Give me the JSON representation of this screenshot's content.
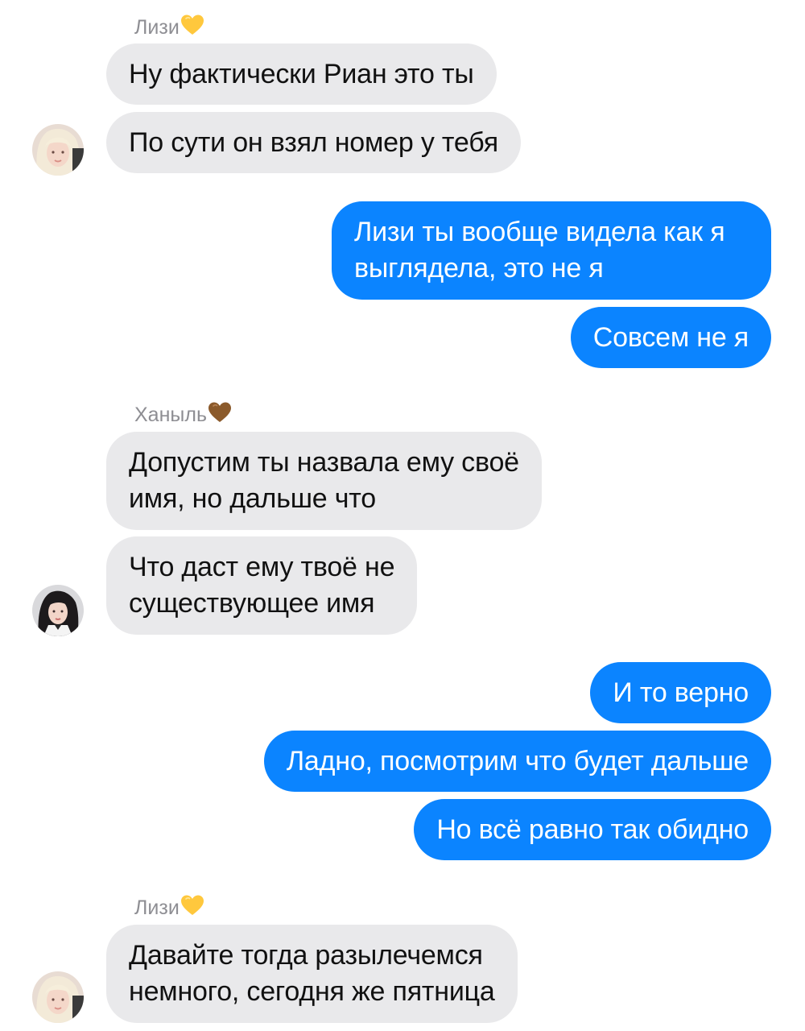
{
  "colors": {
    "incoming_bubble": "#e9e9eb",
    "outgoing_bubble": "#0b84ff",
    "sender_name": "#8e8e93",
    "heart_yellow": "#ffc83d",
    "heart_brown": "#8b5a2b"
  },
  "groups": [
    {
      "sender": "Лизи",
      "sender_icon": "yellow-heart-icon",
      "messages": [
        "Ну фактически Риан это ты",
        "По сути он взял номер у тебя"
      ]
    },
    {
      "sender": "me",
      "messages": [
        "Лизи ты вообще видела как я выглядела, это не я",
        "Совсем не я"
      ]
    },
    {
      "sender": "Ханыль",
      "sender_icon": "brown-heart-icon",
      "messages": [
        "Допустим ты назвала ему своё имя, но дальше что",
        "Что даст ему твоё не существующее имя"
      ]
    },
    {
      "sender": "me",
      "messages": [
        "И то верно",
        "Ладно, посмотрим что будет дальше",
        "Но всё равно так обидно"
      ]
    },
    {
      "sender": "Лизи",
      "sender_icon": "yellow-heart-icon",
      "messages": [
        "Давайте тогда разылечемся немного, сегодня же пятница"
      ]
    }
  ],
  "lines": {
    "m2_0_l1": "Лизи ты вообще видела как я",
    "m2_0_l2": "выглядела, это не я",
    "m3_0_l1": "Допустим ты назвала ему своё",
    "m3_0_l2": "имя, но дальше что",
    "m3_1_l1": "Что даст ему твоё не",
    "m3_1_l2": "существующее имя",
    "m5_0_l1": "Давайте тогда разылечемся",
    "m5_0_l2": "немного, сегодня же пятница"
  }
}
